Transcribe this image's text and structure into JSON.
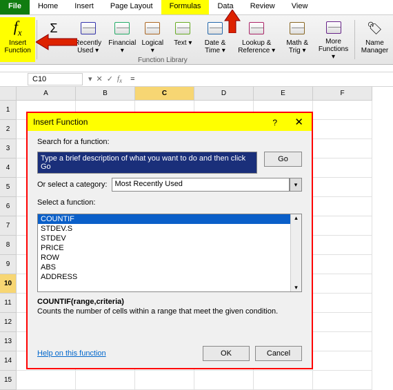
{
  "tabs": {
    "file": "File",
    "home": "Home",
    "insert": "Insert",
    "page_layout": "Page Layout",
    "formulas": "Formulas",
    "data": "Data",
    "review": "Review",
    "view": "View"
  },
  "ribbon": {
    "insert_fn": "Insert\nFunction",
    "autosum": "AutoS",
    "recent": "Recently\nUsed ▾",
    "financial": "Financial\n▾",
    "logical": "Logical\n▾",
    "text": "Text\n▾",
    "datetime": "Date &\nTime ▾",
    "lookup": "Lookup &\nReference ▾",
    "math": "Math\n& Trig ▾",
    "more": "More\nFunctions ▾",
    "name": "Name\nManager",
    "lib_label": "Function Library"
  },
  "fbar": {
    "namebox": "C10",
    "formula": "="
  },
  "cols": [
    "A",
    "B",
    "C",
    "D",
    "E",
    "F"
  ],
  "rows": [
    "1",
    "2",
    "3",
    "4",
    "5",
    "6",
    "7",
    "8",
    "9",
    "10",
    "11",
    "12",
    "13",
    "14",
    "15"
  ],
  "selected_row": "10",
  "selected_col": "C",
  "dialog": {
    "title": "Insert Function",
    "help_icon": "?",
    "close": "✕",
    "search_label": "Search for a function:",
    "search_text": "Type a brief description of what you want to do and then click Go",
    "go": "Go",
    "cat_label": "Or select a category:",
    "cat_value": "Most Recently Used",
    "select_label": "Select a function:",
    "fns": [
      "COUNTIF",
      "STDEV.S",
      "STDEV",
      "PRICE",
      "ROW",
      "ABS",
      "ADDRESS"
    ],
    "sig": "COUNTIF(range,criteria)",
    "desc": "Counts the number of cells within a range that meet the given condition.",
    "help": "Help on this function",
    "ok": "OK",
    "cancel": "Cancel"
  }
}
